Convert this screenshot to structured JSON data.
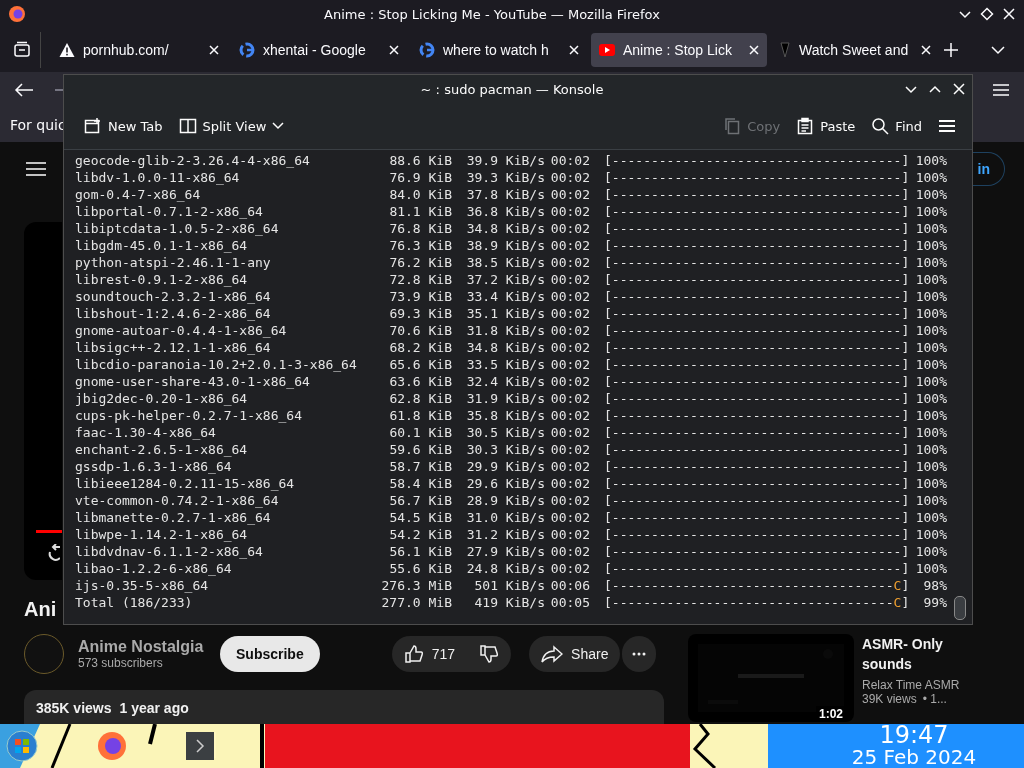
{
  "browser": {
    "title": "Anime : Stop Licking Me - YouTube — Mozilla Firefox",
    "tabs": [
      {
        "label": "pornhub.com/",
        "kind": "warning",
        "selected": false
      },
      {
        "label": "xhentai - Google",
        "kind": "google",
        "selected": false
      },
      {
        "label": "where to watch h",
        "kind": "google",
        "selected": false
      },
      {
        "label": "Anime : Stop Lick",
        "kind": "youtube",
        "selected": true
      },
      {
        "label": "Watch Sweet and",
        "kind": "site",
        "selected": false
      }
    ],
    "notification": "For quic"
  },
  "youtube": {
    "sign_in": "in",
    "title_fragment": "Ani",
    "channel": {
      "name": "Anime Nostalgia",
      "subscribers": "573 subscribers"
    },
    "subscribe": "Subscribe",
    "likes": "717",
    "share": "Share",
    "description": {
      "views": "385K views",
      "age": "1 year ago"
    },
    "suggested": {
      "duration": "1:02",
      "title": "ASMR- Only sounds",
      "channel": "Relax Time ASMR",
      "views": "39K views",
      "age": "• 1..."
    }
  },
  "konsole": {
    "title": "~ : sudo pacman — Konsole",
    "toolbar": [
      {
        "label": "New Tab",
        "kind": "newtab",
        "disabled": false
      },
      {
        "label": "Split View",
        "kind": "split",
        "disabled": false
      },
      {
        "label": "Copy",
        "kind": "copy",
        "disabled": true
      },
      {
        "label": "Paste",
        "kind": "paste",
        "disabled": false
      },
      {
        "label": "Find",
        "kind": "find",
        "disabled": false
      }
    ],
    "rows": [
      {
        "name": "geocode-glib-2-3.26.4-4-x86_64",
        "size": "88.6 KiB",
        "rate": "39.9 KiB/s",
        "time": "00:02",
        "bar": "[-------------------------------------",
        "head": "",
        "end": "]",
        "percent": "100%"
      },
      {
        "name": "libdv-1.0.0-11-x86_64",
        "size": "76.9 KiB",
        "rate": "39.3 KiB/s",
        "time": "00:02",
        "bar": "[-------------------------------------",
        "head": "",
        "end": "]",
        "percent": "100%"
      },
      {
        "name": "gom-0.4-7-x86_64",
        "size": "84.0 KiB",
        "rate": "37.8 KiB/s",
        "time": "00:02",
        "bar": "[-------------------------------------",
        "head": "",
        "end": "]",
        "percent": "100%"
      },
      {
        "name": "libportal-0.7.1-2-x86_64",
        "size": "81.1 KiB",
        "rate": "36.8 KiB/s",
        "time": "00:02",
        "bar": "[-------------------------------------",
        "head": "",
        "end": "]",
        "percent": "100%"
      },
      {
        "name": "libiptcdata-1.0.5-2-x86_64",
        "size": "76.8 KiB",
        "rate": "34.8 KiB/s",
        "time": "00:02",
        "bar": "[-------------------------------------",
        "head": "",
        "end": "]",
        "percent": "100%"
      },
      {
        "name": "libgdm-45.0.1-1-x86_64",
        "size": "76.3 KiB",
        "rate": "38.9 KiB/s",
        "time": "00:02",
        "bar": "[-------------------------------------",
        "head": "",
        "end": "]",
        "percent": "100%"
      },
      {
        "name": "python-atspi-2.46.1-1-any",
        "size": "76.2 KiB",
        "rate": "38.5 KiB/s",
        "time": "00:02",
        "bar": "[-------------------------------------",
        "head": "",
        "end": "]",
        "percent": "100%"
      },
      {
        "name": "librest-0.9.1-2-x86_64",
        "size": "72.8 KiB",
        "rate": "37.2 KiB/s",
        "time": "00:02",
        "bar": "[-------------------------------------",
        "head": "",
        "end": "]",
        "percent": "100%"
      },
      {
        "name": "soundtouch-2.3.2-1-x86_64",
        "size": "73.9 KiB",
        "rate": "33.4 KiB/s",
        "time": "00:02",
        "bar": "[-------------------------------------",
        "head": "",
        "end": "]",
        "percent": "100%"
      },
      {
        "name": "libshout-1:2.4.6-2-x86_64",
        "size": "69.3 KiB",
        "rate": "35.1 KiB/s",
        "time": "00:02",
        "bar": "[-------------------------------------",
        "head": "",
        "end": "]",
        "percent": "100%"
      },
      {
        "name": "gnome-autoar-0.4.4-1-x86_64",
        "size": "70.6 KiB",
        "rate": "31.8 KiB/s",
        "time": "00:02",
        "bar": "[-------------------------------------",
        "head": "",
        "end": "]",
        "percent": "100%"
      },
      {
        "name": "libsigc++-2.12.1-1-x86_64",
        "size": "68.2 KiB",
        "rate": "34.8 KiB/s",
        "time": "00:02",
        "bar": "[-------------------------------------",
        "head": "",
        "end": "]",
        "percent": "100%"
      },
      {
        "name": "libcdio-paranoia-10.2+2.0.1-3-x86_64",
        "size": "65.6 KiB",
        "rate": "33.5 KiB/s",
        "time": "00:02",
        "bar": "[-------------------------------------",
        "head": "",
        "end": "]",
        "percent": "100%"
      },
      {
        "name": "gnome-user-share-43.0-1-x86_64",
        "size": "63.6 KiB",
        "rate": "32.4 KiB/s",
        "time": "00:02",
        "bar": "[-------------------------------------",
        "head": "",
        "end": "]",
        "percent": "100%"
      },
      {
        "name": "jbig2dec-0.20-1-x86_64",
        "size": "62.8 KiB",
        "rate": "31.9 KiB/s",
        "time": "00:02",
        "bar": "[-------------------------------------",
        "head": "",
        "end": "]",
        "percent": "100%"
      },
      {
        "name": "cups-pk-helper-0.2.7-1-x86_64",
        "size": "61.8 KiB",
        "rate": "35.8 KiB/s",
        "time": "00:02",
        "bar": "[-------------------------------------",
        "head": "",
        "end": "]",
        "percent": "100%"
      },
      {
        "name": "faac-1.30-4-x86_64",
        "size": "60.1 KiB",
        "rate": "30.5 KiB/s",
        "time": "00:02",
        "bar": "[-------------------------------------",
        "head": "",
        "end": "]",
        "percent": "100%"
      },
      {
        "name": "enchant-2.6.5-1-x86_64",
        "size": "59.6 KiB",
        "rate": "30.3 KiB/s",
        "time": "00:02",
        "bar": "[-------------------------------------",
        "head": "",
        "end": "]",
        "percent": "100%"
      },
      {
        "name": "gssdp-1.6.3-1-x86_64",
        "size": "58.7 KiB",
        "rate": "29.9 KiB/s",
        "time": "00:02",
        "bar": "[-------------------------------------",
        "head": "",
        "end": "]",
        "percent": "100%"
      },
      {
        "name": "libieee1284-0.2.11-15-x86_64",
        "size": "58.4 KiB",
        "rate": "29.6 KiB/s",
        "time": "00:02",
        "bar": "[-------------------------------------",
        "head": "",
        "end": "]",
        "percent": "100%"
      },
      {
        "name": "vte-common-0.74.2-1-x86_64",
        "size": "56.7 KiB",
        "rate": "28.9 KiB/s",
        "time": "00:02",
        "bar": "[-------------------------------------",
        "head": "",
        "end": "]",
        "percent": "100%"
      },
      {
        "name": "libmanette-0.2.7-1-x86_64",
        "size": "54.5 KiB",
        "rate": "31.0 KiB/s",
        "time": "00:02",
        "bar": "[-------------------------------------",
        "head": "",
        "end": "]",
        "percent": "100%"
      },
      {
        "name": "libwpe-1.14.2-1-x86_64",
        "size": "54.2 KiB",
        "rate": "31.2 KiB/s",
        "time": "00:02",
        "bar": "[-------------------------------------",
        "head": "",
        "end": "]",
        "percent": "100%"
      },
      {
        "name": "libdvdnav-6.1.1-2-x86_64",
        "size": "56.1 KiB",
        "rate": "27.9 KiB/s",
        "time": "00:02",
        "bar": "[-------------------------------------",
        "head": "",
        "end": "]",
        "percent": "100%"
      },
      {
        "name": "libao-1.2.2-6-x86_64",
        "size": "55.6 KiB",
        "rate": "24.8 KiB/s",
        "time": "00:02",
        "bar": "[-------------------------------------",
        "head": "",
        "end": "]",
        "percent": "100%"
      },
      {
        "name": "ijs-0.35-5-x86_64",
        "size": "276.3 MiB",
        "rate": "501 KiB/s",
        "time": "00:06",
        "bar": "[------------------------------------",
        "head": "C",
        "end": "]",
        "percent": "98%"
      },
      {
        "name": "Total (186/233)",
        "size": "277.0 MiB",
        "rate": "419 KiB/s",
        "time": "00:05",
        "bar": "[------------------------------------",
        "head": "C",
        "end": "]",
        "percent": "99%"
      }
    ]
  },
  "taskbar": {
    "time": "19:47",
    "date": "25 Feb 2024"
  }
}
